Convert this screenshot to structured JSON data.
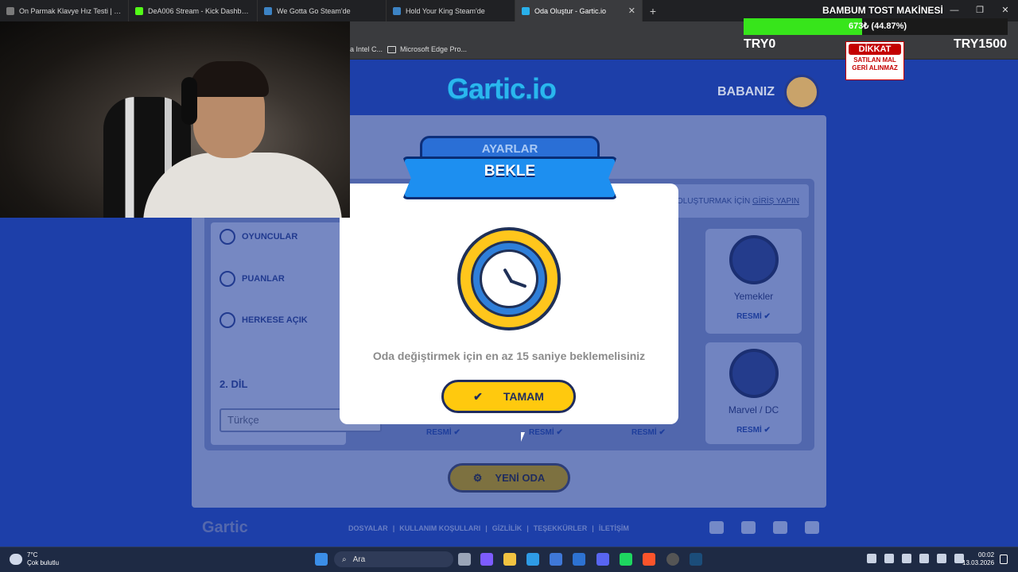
{
  "browser": {
    "tabs": [
      {
        "label": "On Parmak Klavye Hız Testi | m5bilisim",
        "favicon_color": "#7a7a7a"
      },
      {
        "label": "DeA006 Stream - Kick Dashboard",
        "favicon_color": "#53fc18"
      },
      {
        "label": "We Gotta Go Steam'de",
        "favicon_color": "#3c83c4"
      },
      {
        "label": "Hold Your King Steam'de",
        "favicon_color": "#3c83c4"
      },
      {
        "label": "Oda Oluştur - Gartic.io",
        "favicon_color": "#29b0ea"
      }
    ],
    "new_tab": "+",
    "close_tab": "✕",
    "window": {
      "minimize": "—",
      "maximize": "❐",
      "close": "✕"
    },
    "bookmarks": [
      {
        "label": "a Intel C..."
      },
      {
        "label": "Microsoft Edge Pro..."
      }
    ]
  },
  "stream_overlay": {
    "goal_title": "BAMBUM TOST MAKİNESİ",
    "progress_percent": 44.87,
    "progress_text": "673₺ (44.87%)",
    "left_amount": "TRY0",
    "right_amount": "TRY1500",
    "warning_title": "DİKKAT",
    "warning_text": "SATILAN MAL GERİ ALINMAZ"
  },
  "gartic": {
    "logo": "Gartic.io",
    "username": "BABANIZ",
    "login_prompt": "OLUŞTURMAK İÇİN",
    "login_link": "GİRİŞ YAPIN",
    "options": [
      {
        "label": "OYUNCULAR",
        "icon": "person-icon"
      },
      {
        "label": "PUANLAR",
        "icon": "trophy-icon"
      },
      {
        "label": "HERKESE AÇIK",
        "icon": "eye-icon"
      }
    ],
    "second_language_label": "2. DİL",
    "language_value": "Türkçe",
    "themes": [
      {
        "label": "Yemekler",
        "badge": "RESMİ"
      },
      {
        "label": "Marvel / DC",
        "badge": "RESMİ"
      }
    ],
    "bottom_badges": [
      "RESMİ",
      "RESMİ",
      "RESMİ"
    ],
    "new_room_button": "YENİ ODA",
    "footer_logo": "Gartic",
    "footer_links": [
      "DOSYALAR",
      "KULLANIM KOŞULLARI",
      "GİZLİLİK",
      "TEŞEKKÜRLER",
      "İLETİŞİM"
    ],
    "social": [
      "twitter-icon",
      "youtube-icon",
      "instagram-icon",
      "discord-icon"
    ]
  },
  "modal": {
    "ribbon_top": "AYARLAR",
    "ribbon_label": "BEKLE",
    "message": "Oda değiştirmek için en az 15 saniye beklemelisiniz",
    "ok_button": "TAMAM"
  },
  "taskbar": {
    "weather_temp": "7°C",
    "weather_desc": "Çok bulutlu",
    "search_placeholder": "Ara",
    "time": "00:02",
    "date": "13.03.2026"
  },
  "colors": {
    "page_bg": "#1d3fa9",
    "modal_button": "#ffc90e",
    "progress": "#37e51b",
    "ribbon": "#1d8ff0"
  }
}
